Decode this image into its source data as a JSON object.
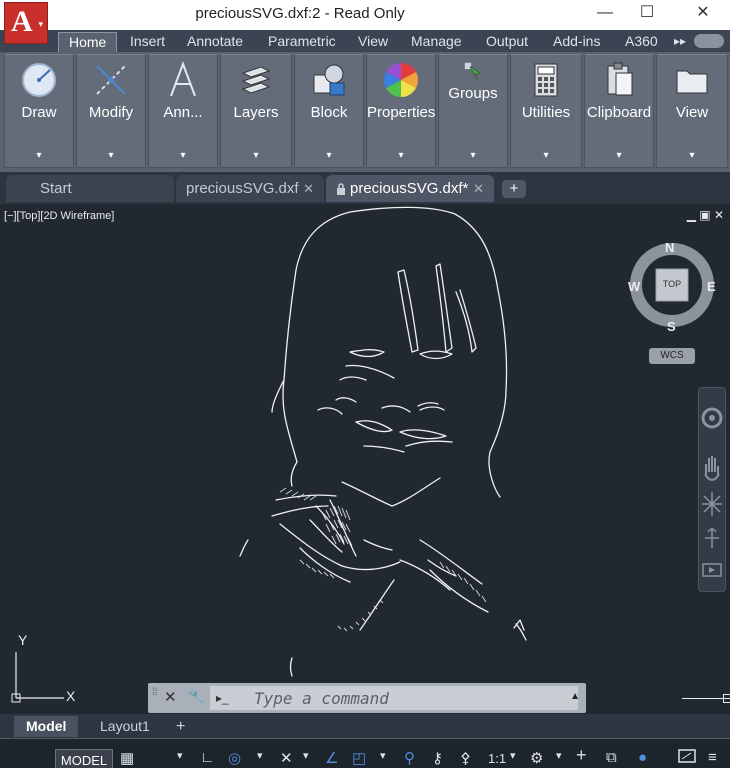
{
  "window": {
    "title": "preciousSVG.dxf:2 - Read Only",
    "minimize": "—",
    "maximize": "☐",
    "close": "✕"
  },
  "app_menu": {
    "letter": "A",
    "arrow": "▾"
  },
  "ribbon_tabs": [
    "Home",
    "Insert",
    "Annotate",
    "Parametric",
    "View",
    "Manage",
    "Output",
    "Add-ins",
    "A360"
  ],
  "ribbon_more": "▸▸",
  "ribbon_panels": [
    {
      "label": "Draw",
      "icon": "draw-circle-icon"
    },
    {
      "label": "Modify",
      "icon": "modify-icon"
    },
    {
      "label": "Ann...",
      "icon": "annotation-a-icon"
    },
    {
      "label": "Layers",
      "icon": "layers-icon"
    },
    {
      "label": "Block",
      "icon": "block-icon"
    },
    {
      "label": "Properties",
      "icon": "properties-color-wheel-icon"
    },
    {
      "label": "Groups",
      "icon": "groups-icon"
    },
    {
      "label": "Utilities",
      "icon": "calculator-icon"
    },
    {
      "label": "Clipboard",
      "icon": "clipboard-icon"
    },
    {
      "label": "View",
      "icon": "view-folder-icon"
    }
  ],
  "panel_drop": "▾",
  "doc_tabs": {
    "start": "Start",
    "tab1": "preciousSVG.dxf",
    "tab2": "preciousSVG.dxf*",
    "close": "✕",
    "add": "+"
  },
  "viewport": {
    "controls": "[−][Top][2D Wireframe]",
    "window_controls": "▁ ▣ ✕"
  },
  "viewcube": {
    "n": "N",
    "s": "S",
    "e": "E",
    "w": "W",
    "face": "TOP",
    "wcs": "WCS"
  },
  "ucs": {
    "y": "Y",
    "x": "X"
  },
  "command": {
    "placeholder": "Type a command",
    "close": "✕",
    "wrench": "🔧",
    "prompt": "▸_",
    "dropdown": "▲"
  },
  "layout_tabs": {
    "model": "Model",
    "layout1": "Layout1",
    "add": "+"
  },
  "status": {
    "model": "MODEL",
    "scale": "1:1",
    "items": [
      "▦",
      "▾",
      "∟",
      "◎",
      "▾",
      "✕",
      "▾",
      "∠",
      "◰",
      "▾",
      "⚲",
      "⚷",
      "⚴",
      "▾",
      "⚙",
      "▾",
      "+",
      "⧉",
      "●",
      "≡"
    ]
  },
  "colors": {
    "canvas": "#212830",
    "ribbon": "#5a6270",
    "accent_red": "#c9302c"
  }
}
